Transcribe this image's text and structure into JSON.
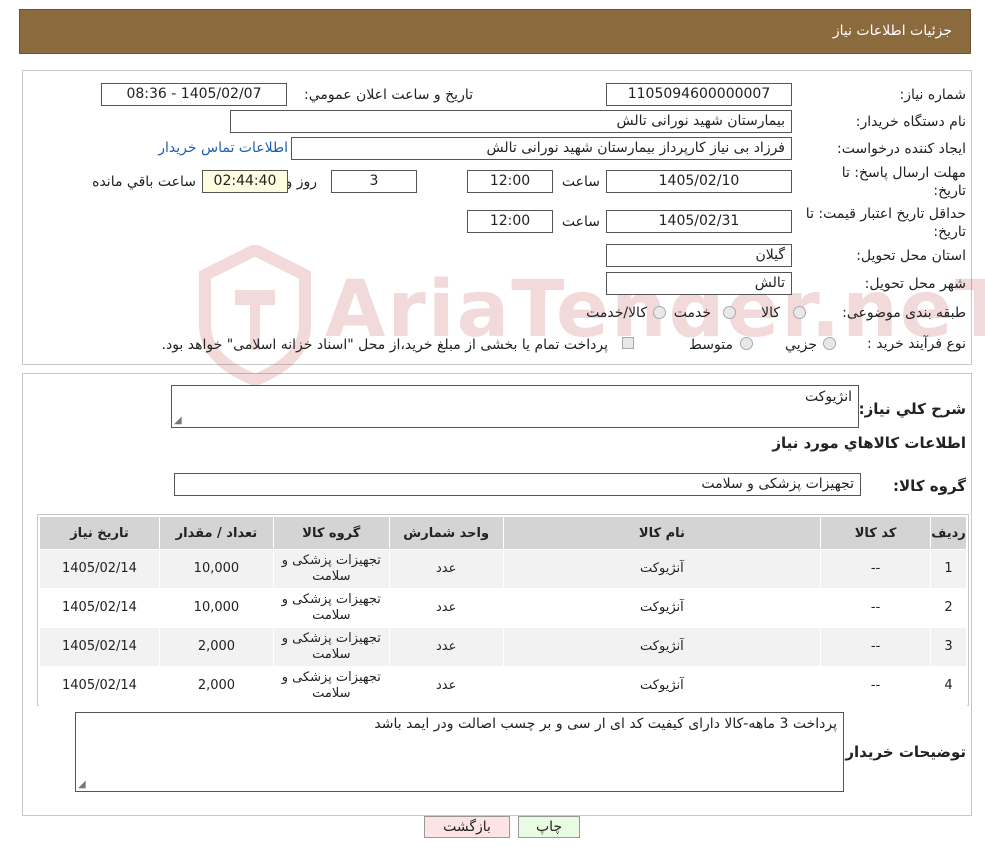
{
  "header": {
    "title": "جزئیات اطلاعات نیاز"
  },
  "form": {
    "need_number_label": "شماره نیاز:",
    "need_number": "1105094600000007",
    "announce_label": "تاریخ و ساعت اعلان عمومي:",
    "announce_value": "1405/02/07 - 08:36",
    "buyer_org_label": "نام دستگاه خريدار:",
    "buyer_org": "بیمارستان شهید نورانی تالش",
    "requester_label": "ايجاد کننده درخواست:",
    "requester": "فرزاد بی نیاز کارپرداز بیمارستان شهید نورانی تالش",
    "contact_link": "اطلاعات تماس خريدار",
    "reply_deadline_label_1": "مهلت ارسال پاسخ: تا",
    "reply_deadline_label_2": "تاریخ:",
    "reply_date": "1405/02/10",
    "time_label": "ساعت",
    "reply_time": "12:00",
    "days_value": "3",
    "days_label": "روز و",
    "remaining_time": "02:44:40",
    "remaining_label": "ساعت باقي مانده",
    "price_validity_label_1": "حداقل تاريخ اعتبار قيمت: تا",
    "price_validity_label_2": "تاریخ:",
    "price_date": "1405/02/31",
    "price_time": "12:00",
    "province_label": "استان محل تحويل:",
    "province": "گیلان",
    "city_label": "شهر محل تحويل:",
    "city": "تالش",
    "category_label": "طبقه بندی موضوعی:",
    "category_options": [
      "کالا",
      "خدمت",
      "کالا/خدمت"
    ],
    "process_label": "نوع فرآيند خريد :",
    "process_options": [
      "جزيي",
      "متوسط"
    ],
    "payment_note": "پرداخت تمام یا بخشی از مبلغ خرید،از محل \"اسناد خزانه اسلامی\" خواهد بود."
  },
  "details": {
    "summary_label": "شرح کلي نياز:",
    "summary": "انژیوکت",
    "goods_info_title": "اطلاعات کالاهاي مورد نياز",
    "goods_group_label": "گروه کالا:",
    "goods_group": "تجهیزات پزشکی و سلامت"
  },
  "table": {
    "headers": [
      "رديف",
      "کد کالا",
      "نام کالا",
      "واحد شمارش",
      "گروه کالا",
      "تعداد / مقدار",
      "تاريخ نياز"
    ],
    "rows": [
      [
        "1",
        "--",
        "آنژیوکت",
        "عدد",
        "تجهیزات پزشکی و سلامت",
        "10,000",
        "1405/02/14"
      ],
      [
        "2",
        "--",
        "آنژیوکت",
        "عدد",
        "تجهیزات پزشکی و سلامت",
        "10,000",
        "1405/02/14"
      ],
      [
        "3",
        "--",
        "آنژیوکت",
        "عدد",
        "تجهیزات پزشکی و سلامت",
        "2,000",
        "1405/02/14"
      ],
      [
        "4",
        "--",
        "آنژیوکت",
        "عدد",
        "تجهیزات پزشکی و سلامت",
        "2,000",
        "1405/02/14"
      ]
    ]
  },
  "buyer_notes": {
    "label": "توضيحات خريدار:",
    "text": "پرداخت 3 ماهه-کالا دارای کیفیت  کد ای ار سی و بر چسب اصالت ودر ایمد باشد"
  },
  "buttons": {
    "print": "چاپ",
    "back": "بازگشت"
  },
  "watermark": {
    "text": "AriaTender.neT"
  },
  "colors": {
    "header_bg": "#8b6a3e",
    "link": "#1a5fb4",
    "back_button_bg": "#fde4e4",
    "print_button_bg": "#eafbe4"
  }
}
